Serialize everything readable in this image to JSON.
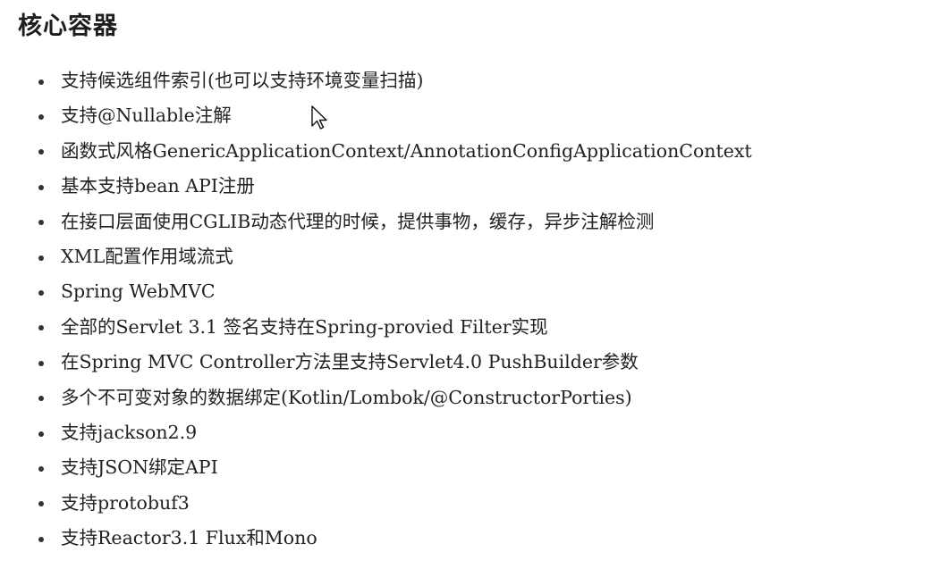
{
  "page": {
    "title": "核心容器"
  },
  "items": [
    "支持候选组件索引(也可以支持环境变量扫描)",
    "支持@Nullable注解",
    "函数式风格GenericApplicationContext/AnnotationConfigApplicationContext",
    "基本支持bean API注册",
    "在接口层面使用CGLIB动态代理的时候，提供事物，缓存，异步注解检测",
    "XML配置作用域流式",
    "Spring WebMVC",
    "全部的Servlet 3.1 签名支持在Spring-provied Filter实现",
    "在Spring MVC Controller方法里支持Servlet4.0 PushBuilder参数",
    "多个不可变对象的数据绑定(Kotlin/Lombok/@ConstructorPorties)",
    "支持jackson2.9",
    "支持JSON绑定API",
    "支持protobuf3",
    "支持Reactor3.1 Flux和Mono"
  ],
  "icons": {
    "cursor": "mouse-pointer-icon"
  },
  "colors": {
    "text": "#222222",
    "heading": "#1e1e1e",
    "bullet": "#333333",
    "background": "#ffffff"
  }
}
